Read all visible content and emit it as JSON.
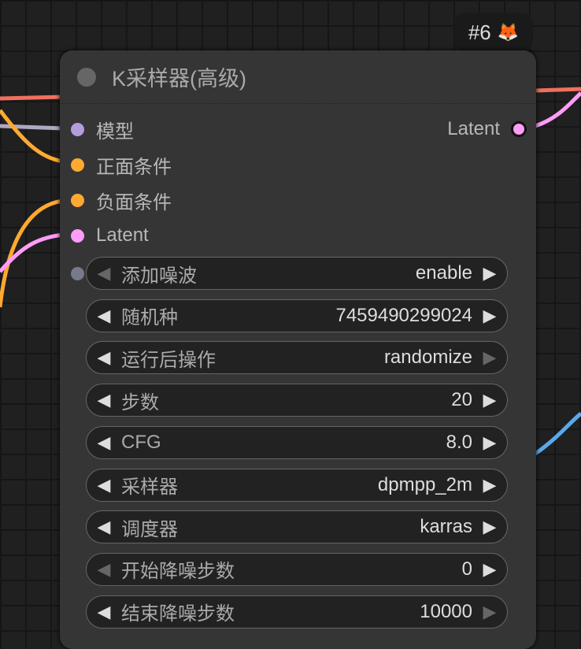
{
  "badge": {
    "label": "#6",
    "icon": "fox-icon"
  },
  "node": {
    "title": "K采样器(高级)",
    "inputs": [
      {
        "label": "模型",
        "color": "#b39ddb"
      },
      {
        "label": "正面条件",
        "color": "#ffa931"
      },
      {
        "label": "负面条件",
        "color": "#ffa931"
      },
      {
        "label": "Latent",
        "color": "#ff9cf9"
      }
    ],
    "output": {
      "label": "Latent",
      "color": "#ff9cf9"
    },
    "widgets": [
      {
        "label": "添加噪波",
        "value": "enable"
      },
      {
        "label": "随机种",
        "value": "7459490299024"
      },
      {
        "label": "运行后操作",
        "value": "randomize"
      },
      {
        "label": "步数",
        "value": "20"
      },
      {
        "label": "CFG",
        "value": "8.0"
      },
      {
        "label": "采样器",
        "value": "dpmpp_2m"
      },
      {
        "label": "调度器",
        "value": "karras"
      },
      {
        "label": "开始降噪步数",
        "value": "0"
      },
      {
        "label": "结束降噪步数",
        "value": "10000"
      }
    ]
  }
}
